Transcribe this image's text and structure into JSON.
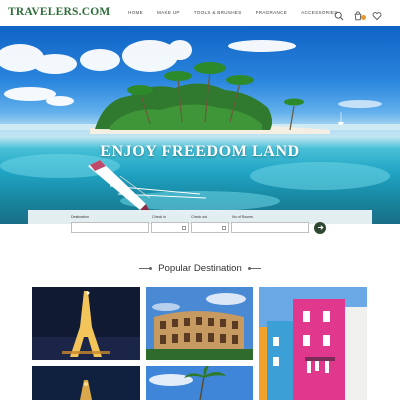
{
  "header": {
    "logo": "TRAVELERS.COM",
    "nav": [
      "HOME",
      "MAKE UP",
      "TOOLS & BRUSHES",
      "FRAGRANCE",
      "ACCESSORIES"
    ],
    "icons": [
      "search-icon",
      "cart-icon",
      "heart-icon"
    ],
    "brand_color": "#2f6e3a",
    "badge_color": "#e79a2b"
  },
  "hero": {
    "title": "ENJOY FREEDOM LAND"
  },
  "booking": {
    "destination_label": "Destination",
    "checkin_label": "Check in",
    "checkout_label": "Check out",
    "rooms_label": "No of Rooms",
    "submit_icon": "arrow-right-icon",
    "button_color": "#2d4730"
  },
  "section": {
    "title": "Popular Destination"
  },
  "gallery": [
    "eiffel-tower-photo",
    "colosseum-photo",
    "colorful-houses-photo",
    "tower-night-photo",
    "palm-beach-photo"
  ]
}
